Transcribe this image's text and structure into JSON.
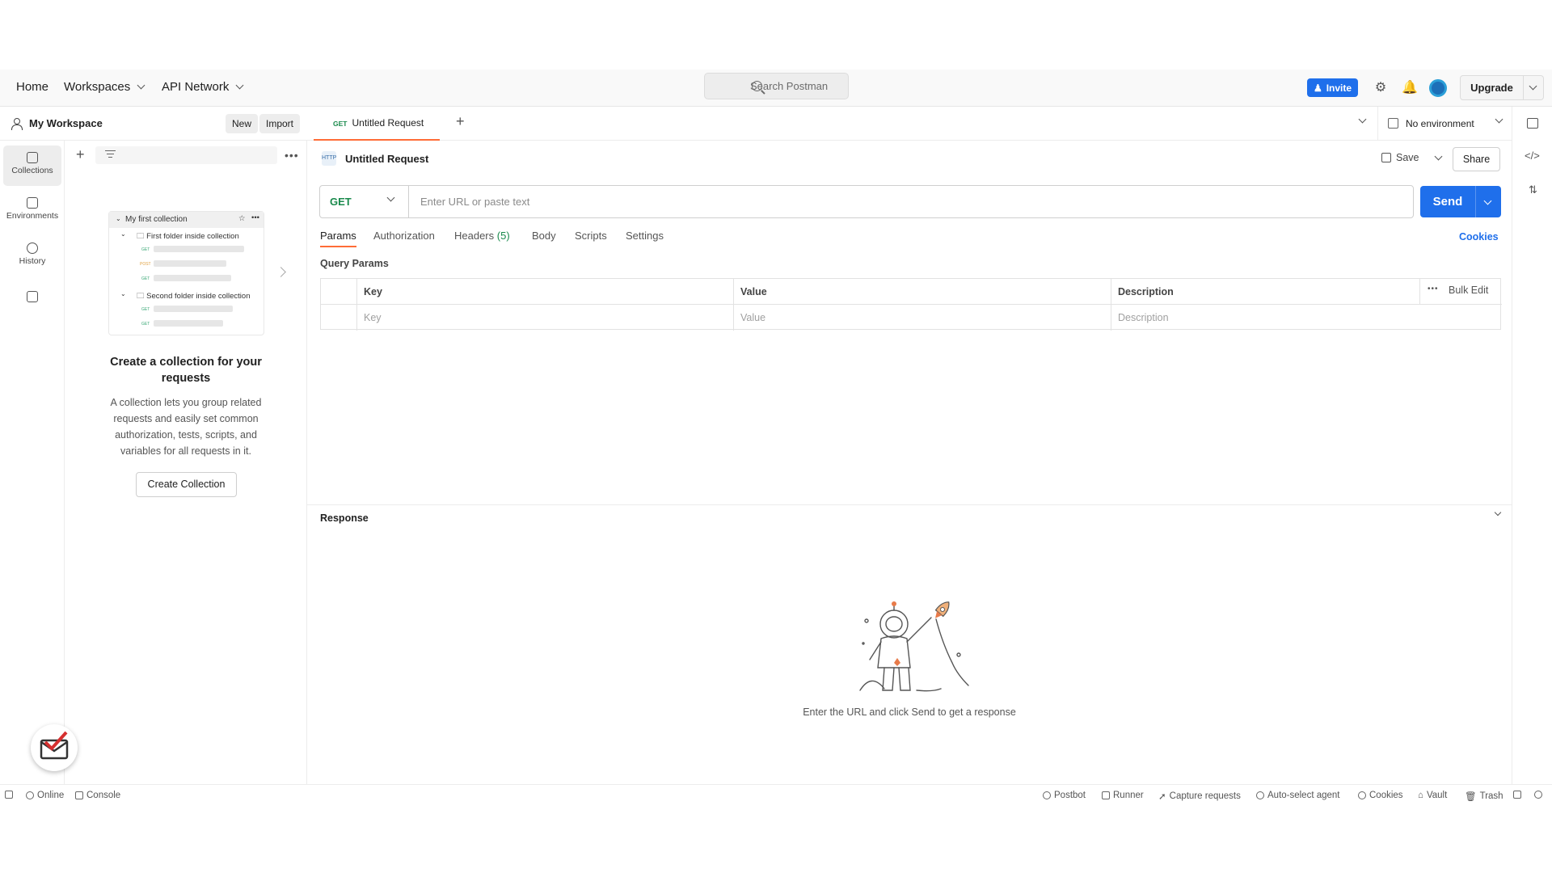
{
  "header": {
    "nav": [
      "Home",
      "Workspaces",
      "API Network"
    ],
    "search_placeholder": "Search Postman",
    "invite_label": "Invite",
    "upgrade_label": "Upgrade"
  },
  "workspace": {
    "title": "My Workspace",
    "new_label": "New",
    "import_label": "Import"
  },
  "rail": {
    "items": [
      "Collections",
      "Environments",
      "History"
    ]
  },
  "sidebar": {
    "preview": {
      "collection": "My first collection",
      "folder1": "First folder inside collection",
      "folder2": "Second folder inside collection",
      "methods": [
        "GET",
        "POST",
        "GET",
        "GET",
        "GET"
      ]
    },
    "empty_title": "Create a collection for your requests",
    "empty_desc": "A collection lets you group related requests and easily set common authorization, tests, scripts, and variables for all requests in it.",
    "create_label": "Create Collection"
  },
  "tabs": [
    {
      "method": "GET",
      "label": "Untitled Request"
    }
  ],
  "environment": "No environment",
  "request": {
    "title": "Untitled Request",
    "icon_text": "HTTP",
    "save_label": "Save",
    "share_label": "Share",
    "method": "GET",
    "url_placeholder": "Enter URL or paste text",
    "send_label": "Send",
    "subtabs": [
      "Params",
      "Authorization",
      "Headers",
      "Body",
      "Scripts",
      "Settings"
    ],
    "headers_count": "(5)",
    "cookies_label": "Cookies",
    "query_params_title": "Query Params",
    "columns": [
      "Key",
      "Value",
      "Description"
    ],
    "placeholders": [
      "Key",
      "Value",
      "Description"
    ],
    "bulk_edit": "Bulk Edit"
  },
  "response": {
    "title": "Response",
    "message": "Enter the URL and click Send to get a response"
  },
  "status_bar": {
    "left": [
      "Online",
      "Console"
    ],
    "right": [
      "Postbot",
      "Runner",
      "Capture requests",
      "Auto-select agent",
      "Cookies",
      "Vault",
      "Trash"
    ]
  },
  "colors": {
    "accent": "#ff6c37",
    "primary": "#1f6feb",
    "get_method": "#1a8a4c"
  }
}
